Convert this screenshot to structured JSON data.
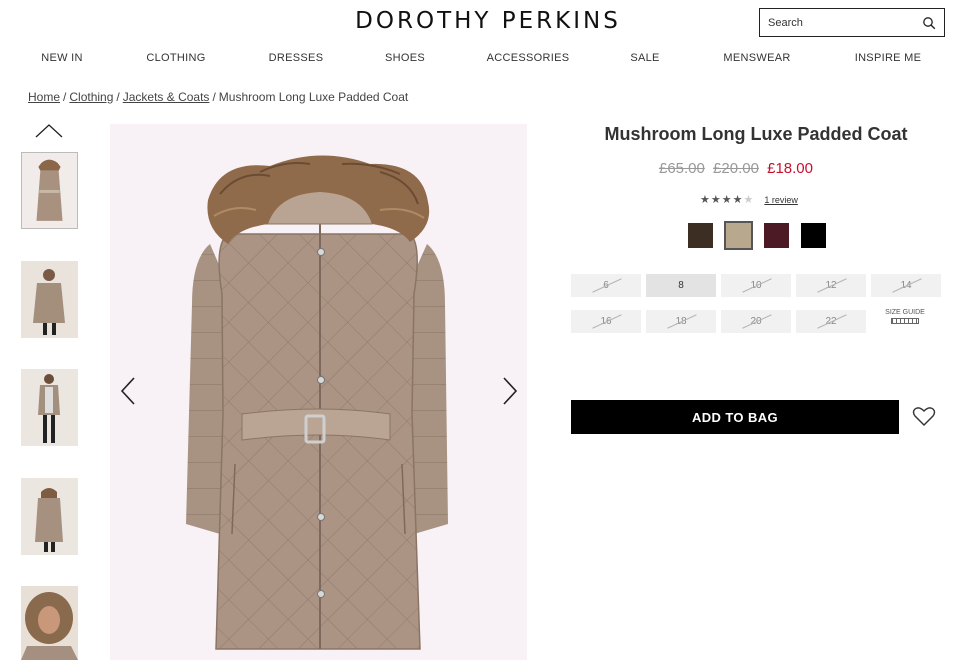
{
  "header": {
    "logo": "DOROTHY PERKINS",
    "search_placeholder": "Search"
  },
  "nav": [
    "NEW IN",
    "CLOTHING",
    "DRESSES",
    "SHOES",
    "ACCESSORIES",
    "SALE",
    "MENSWEAR",
    "INSPIRE ME"
  ],
  "breadcrumb": {
    "links": [
      "Home",
      "Clothing",
      "Jackets & Coats"
    ],
    "separator": "/",
    "current": "Mushroom Long Luxe Padded Coat"
  },
  "product": {
    "title": "Mushroom Long Luxe Padded Coat",
    "prices": {
      "was_1": "£65.00",
      "was_2": "£20.00",
      "now": "£18.00"
    },
    "rating": {
      "stars": 4,
      "max": 5,
      "review_text": "1 review"
    },
    "swatches": [
      {
        "name": "dark brown",
        "color": "#3d2e24",
        "selected": false
      },
      {
        "name": "mushroom",
        "color": "#b8a88d",
        "selected": true
      },
      {
        "name": "burgundy",
        "color": "#4b1a25",
        "selected": false
      },
      {
        "name": "black",
        "color": "#000000",
        "selected": false
      }
    ],
    "sizes": [
      {
        "label": "6",
        "available": false
      },
      {
        "label": "8",
        "available": true
      },
      {
        "label": "10",
        "available": false
      },
      {
        "label": "12",
        "available": false
      },
      {
        "label": "14",
        "available": false
      },
      {
        "label": "16",
        "available": false
      },
      {
        "label": "18",
        "available": false
      },
      {
        "label": "20",
        "available": false
      },
      {
        "label": "22",
        "available": false
      }
    ],
    "size_guide_label": "SIZE GUIDE",
    "add_to_bag_label": "ADD TO BAG"
  },
  "colors": {
    "sale_price": "#c8102e",
    "button_bg": "#000000",
    "image_bg": "#f8f1f5"
  },
  "icons": [
    "search-icon",
    "chevron-up-icon",
    "chevron-left-icon",
    "chevron-right-icon",
    "heart-icon",
    "star-icon",
    "ruler-icon"
  ]
}
